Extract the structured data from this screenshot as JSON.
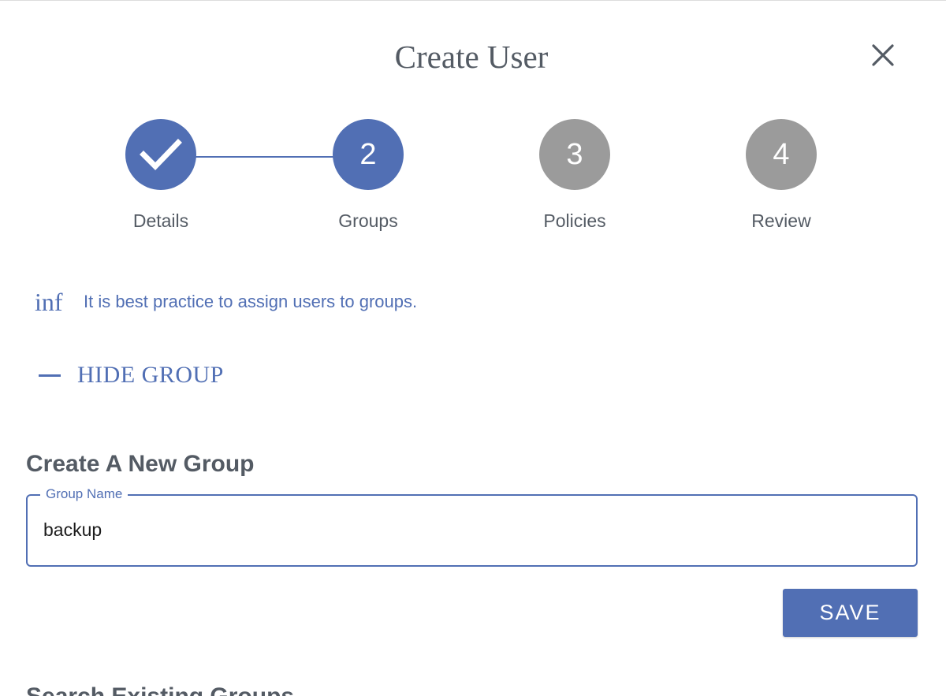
{
  "dialog": {
    "title": "Create User",
    "close_icon": "close-icon"
  },
  "stepper": {
    "steps": [
      {
        "number": "",
        "label": "Details",
        "state": "complete",
        "icon": "check-icon"
      },
      {
        "number": "2",
        "label": "Groups",
        "state": "active"
      },
      {
        "number": "3",
        "label": "Policies",
        "state": "pending"
      },
      {
        "number": "4",
        "label": "Review",
        "state": "pending"
      }
    ]
  },
  "info": {
    "icon_text": "inf",
    "icon": "info-icon",
    "message": "It is best practice to assign users to groups."
  },
  "group_toggle": {
    "icon": "minus-icon",
    "label": "HIDE GROUP"
  },
  "new_group": {
    "heading": "Create A New Group",
    "field_label": "Group Name",
    "field_value": "backup",
    "save_label": "SAVE"
  },
  "existing_groups": {
    "heading": "Search Existing Groups"
  },
  "colors": {
    "accent": "#516fb4",
    "pending": "#9b9b9b",
    "text": "#545b64"
  }
}
